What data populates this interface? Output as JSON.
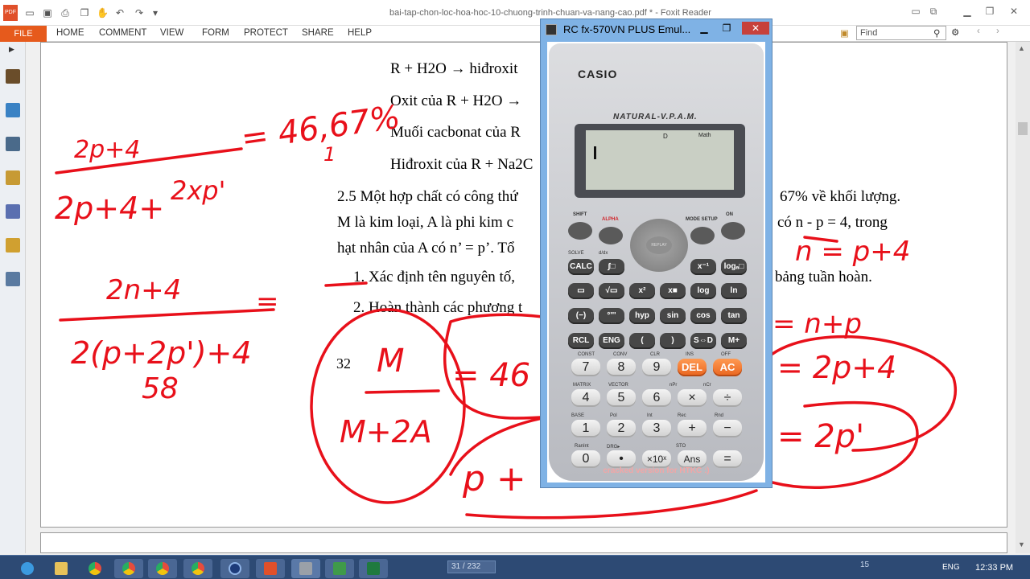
{
  "window": {
    "doc_title": "bai-tap-chon-loc-hoa-hoc-10-chuong-trinh-chuan-va-nang-cao.pdf * - Foxit Reader",
    "minimize": "▁",
    "restore": "❐",
    "close": "✕"
  },
  "quick_access": [
    "open-icon",
    "save-icon",
    "print-icon",
    "undo-icon",
    "redo-icon"
  ],
  "ribbon": {
    "file": "FILE",
    "tabs": [
      "HOME",
      "COMMENT",
      "VIEW",
      "FORM",
      "PROTECT",
      "SHARE",
      "HELP"
    ],
    "find_placeholder": "Find"
  },
  "document": {
    "lines": [
      "R  +  H2O →  hiđroxit",
      "Oxit của R + H2O  →",
      "Muối cacbonat của R",
      "Hiđroxit của R + Na2C",
      "2.5 Một hợp chất có công thứ",
      "67% về khối lượng.",
      "M là kim loại, A là phi kim c",
      "có n - p = 4, trong",
      "hạt nhân của A có n’ = p’. Tổ",
      "1. Xác định tên nguyên tố,",
      "bảng tuần hoàn.",
      "2. Hoàn thành các phương t"
    ],
    "page_number": "32"
  },
  "handwriting": [
    "2p+4",
    "2p+4+",
    "2xp'",
    "= 46,67%",
    "1",
    "2n+4",
    "2(p+2p')+4",
    "=",
    "58",
    "M",
    "M+2A",
    "= 46",
    "n = p+4",
    "= n+p",
    "= 2p+4",
    "= 2p'",
    "p +"
  ],
  "calculator": {
    "window_title": "RC fx-570VN PLUS Emul...",
    "brand": "CASIO",
    "model_line": "NATURAL-V.P.A.M.",
    "lcd_indicator_1": "D",
    "lcd_indicator_2": "Math",
    "watermark": "cracked version for HTKC :)",
    "top_labels": [
      "SHIFT",
      "ALPHA",
      "MODE SETUP",
      "ON"
    ],
    "nav_label": "REPLAY",
    "rows": [
      [
        "CALC",
        "∫□",
        "x⁻¹",
        "logₐ□"
      ],
      [
        "▭",
        "√▭",
        "x²",
        "x■",
        "log",
        "ln"
      ],
      [
        "(−)",
        "°'''",
        "hyp",
        "sin",
        "cos",
        "tan"
      ],
      [
        "RCL",
        "ENG",
        "(",
        ")",
        "S⇔D",
        "M+"
      ]
    ],
    "numpad": [
      [
        "7",
        "8",
        "9",
        "DEL",
        "AC"
      ],
      [
        "4",
        "5",
        "6",
        "×",
        "÷"
      ],
      [
        "1",
        "2",
        "3",
        "+",
        "−"
      ],
      [
        "0",
        "•",
        "×10ˣ",
        "Ans",
        "="
      ]
    ],
    "small_labels": [
      "SOLVE",
      "d/dx",
      "CONST",
      "CONV",
      "CLR",
      "INS",
      "OFF",
      "MATRIX",
      "VECTOR",
      "nPr",
      "GCD",
      "nCr",
      "LCM",
      "STAT/DIST",
      "CMPLX",
      "BASE",
      "Pol",
      "Int",
      "Rec",
      "Intg",
      "Rnd",
      "Ran#",
      "RanInt",
      "DRG▸",
      "PreAns",
      "STO",
      "%",
      "M−",
      "M"
    ]
  },
  "statusbar": {
    "page_box": "31 / 232",
    "page_info": "15"
  },
  "tray": {
    "lang": "ENG",
    "time": "12:33 PM"
  },
  "colors": {
    "ink": "#e8101a",
    "file_tab": "#e65a1c",
    "taskbar": "#2d4a74",
    "calc_frame": "#7fb2e5"
  }
}
